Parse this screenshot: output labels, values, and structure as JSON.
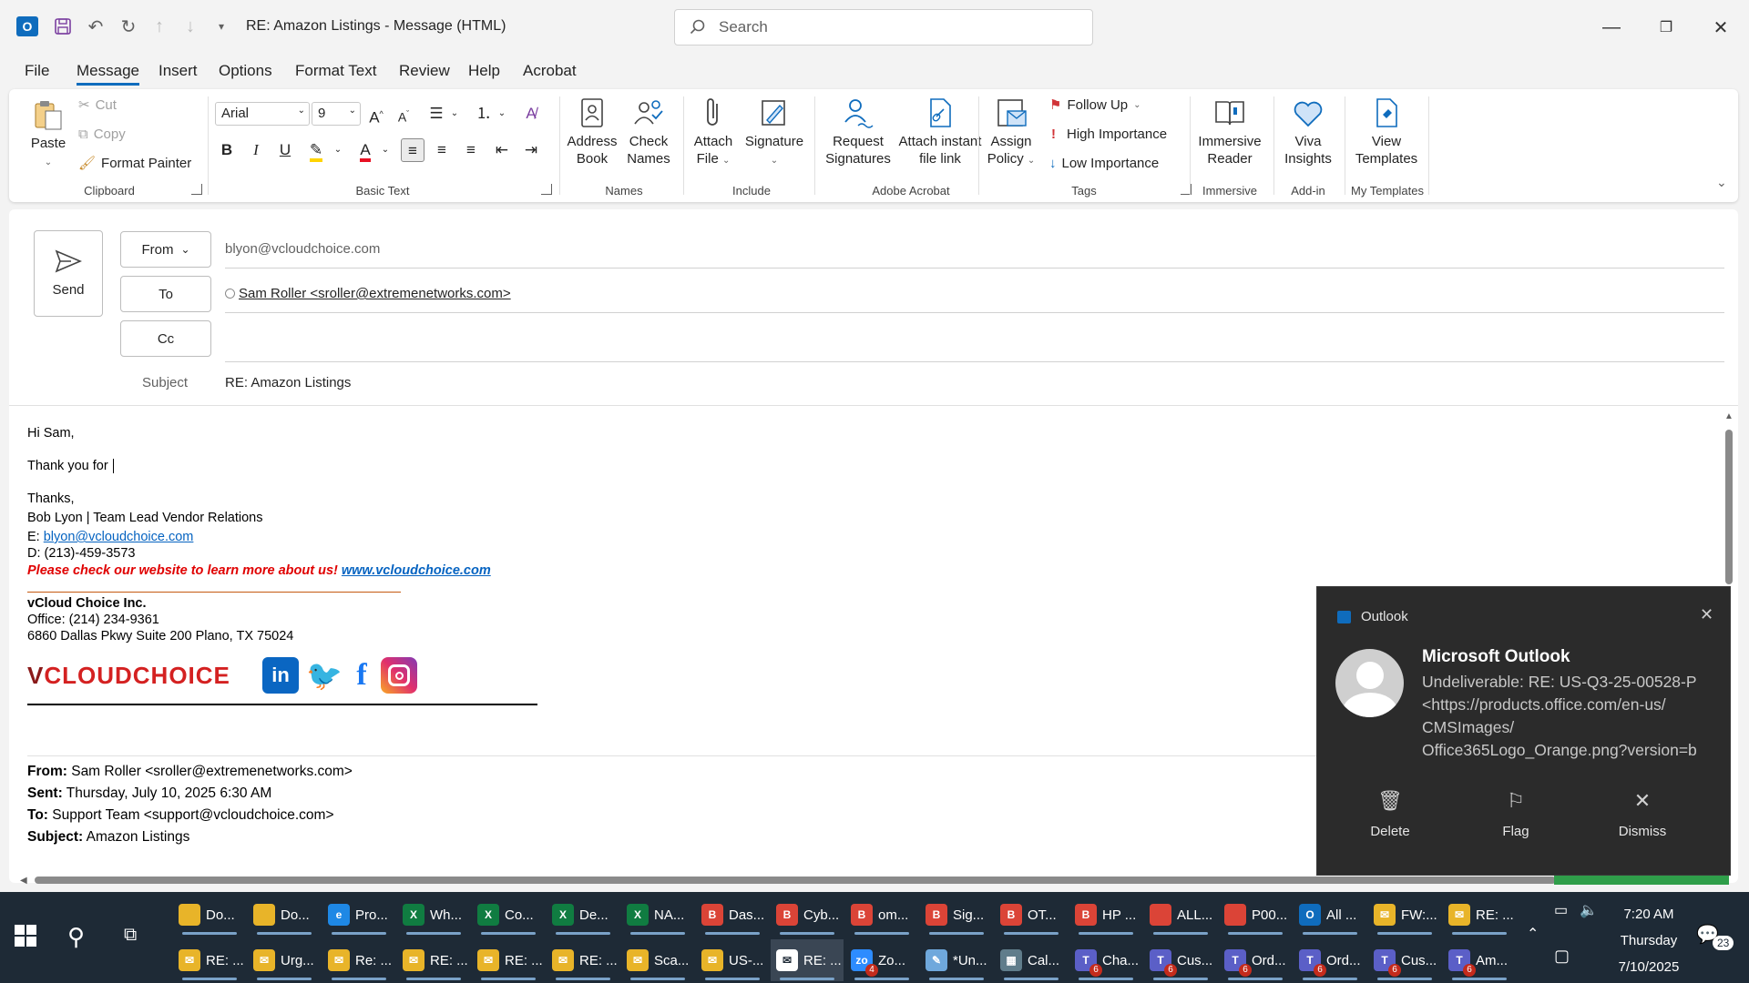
{
  "title_bar": {
    "doc_title": "RE: Amazon Listings  -  Message (HTML)",
    "search_placeholder": "Search"
  },
  "menu_tabs": [
    "File",
    "Message",
    "Insert",
    "Options",
    "Format Text",
    "Review",
    "Help",
    "Acrobat"
  ],
  "ribbon": {
    "clipboard": {
      "paste": "Paste",
      "cut": "Cut",
      "copy": "Copy",
      "format_painter": "Format Painter",
      "group": "Clipboard"
    },
    "basic_text": {
      "font": "Arial",
      "size": "9",
      "group": "Basic Text"
    },
    "names": {
      "address_book_1": "Address",
      "address_book_2": "Book",
      "check_names_1": "Check",
      "check_names_2": "Names",
      "group": "Names"
    },
    "include": {
      "attach_1": "Attach",
      "attach_2": "File",
      "signature": "Signature",
      "group": "Include"
    },
    "adobe": {
      "request_1": "Request",
      "request_2": "Signatures",
      "attach_link_1": "Attach instant",
      "attach_link_2": "file link",
      "group": "Adobe Acrobat"
    },
    "tags": {
      "assign_1": "Assign",
      "assign_2": "Policy",
      "follow_up": "Follow Up",
      "high": "High Importance",
      "low": "Low Importance",
      "group": "Tags"
    },
    "immersive": {
      "btn_1": "Immersive",
      "btn_2": "Reader",
      "group": "Immersive"
    },
    "addin": {
      "btn_1": "Viva",
      "btn_2": "Insights",
      "group": "Add-in"
    },
    "templates": {
      "btn_1": "View",
      "btn_2": "Templates",
      "group": "My Templates"
    }
  },
  "compose": {
    "send": "Send",
    "from_btn": "From",
    "from_value": "blyon@vcloudchoice.com",
    "to_btn": "To",
    "to_value": "Sam Roller <sroller@extremenetworks.com>",
    "cc_btn": "Cc",
    "subject_label": "Subject",
    "subject_value": "RE: Amazon Listings"
  },
  "body": {
    "greeting": "Hi Sam,",
    "line1": "Thank you for ",
    "thanks": "Thanks,",
    "sig_name": "Bob Lyon | Team Lead Vendor Relations",
    "sig_email_label": "E: ",
    "sig_email": "blyon@vcloudchoice.com",
    "sig_phone": "D: (213)-459-3573",
    "sig_promo": "Please check our website to learn more about us! ",
    "sig_website": "www.vcloudchoice.com",
    "company": "vCloud Choice Inc.",
    "office": "Office: (214) 234-9361",
    "address": "6860 Dallas Pkwy Suite 200 Plano, TX 75024",
    "logo_text": "VCLOUDCHOICE",
    "quoted": {
      "from_label": "From:",
      "from": " Sam Roller <sroller@extremenetworks.com>",
      "sent_label": "Sent:",
      "sent": " Thursday, July 10, 2025 6:30 AM",
      "to_label": "To:",
      "to": " Support Team <support@vcloudchoice.com>",
      "subject_label": "Subject:",
      "subject": " Amazon Listings"
    }
  },
  "toast": {
    "app": "Outlook",
    "title": "Microsoft Outlook",
    "message": "Undeliverable: RE: US-Q3-25-00528-P\n<https://products.office.com/en-us/\nCMSImages/\nOffice365Logo_Orange.png?version=b",
    "delete": "Delete",
    "flag": "Flag",
    "dismiss": "Dismiss"
  },
  "taskbar": {
    "row1": [
      {
        "label": "Do...",
        "color": "#e8b429",
        "glyph": ""
      },
      {
        "label": "Do...",
        "color": "#e8b429",
        "glyph": ""
      },
      {
        "label": "Pro...",
        "color": "#1e88e5",
        "glyph": "e"
      },
      {
        "label": "Wh...",
        "color": "#107c41",
        "glyph": "X"
      },
      {
        "label": "Co...",
        "color": "#107c41",
        "glyph": "X"
      },
      {
        "label": "De...",
        "color": "#107c41",
        "glyph": "X"
      },
      {
        "label": "NA...",
        "color": "#107c41",
        "glyph": "X"
      },
      {
        "label": "Das...",
        "color": "#db4437",
        "glyph": "B"
      },
      {
        "label": "Cyb...",
        "color": "#db4437",
        "glyph": "B"
      },
      {
        "label": "om...",
        "color": "#db4437",
        "glyph": "B"
      },
      {
        "label": "Sig...",
        "color": "#db4437",
        "glyph": "B"
      },
      {
        "label": "OT...",
        "color": "#db4437",
        "glyph": "B"
      },
      {
        "label": "HP ...",
        "color": "#db4437",
        "glyph": "B"
      },
      {
        "label": "ALL...",
        "color": "#db4437",
        "glyph": ""
      },
      {
        "label": "P00...",
        "color": "#db4437",
        "glyph": ""
      },
      {
        "label": "All ...",
        "color": "#0f6cbd",
        "glyph": "O"
      },
      {
        "label": "FW:...",
        "color": "#e8b429",
        "glyph": "✉"
      },
      {
        "label": "RE: ...",
        "color": "#e8b429",
        "glyph": "✉"
      }
    ],
    "row2": [
      {
        "label": "RE: ...",
        "color": "#e8b429",
        "glyph": "✉"
      },
      {
        "label": "Urg...",
        "color": "#e8b429",
        "glyph": "✉"
      },
      {
        "label": "Re: ...",
        "color": "#e8b429",
        "glyph": "✉"
      },
      {
        "label": "RE: ...",
        "color": "#e8b429",
        "glyph": "✉"
      },
      {
        "label": "RE: ...",
        "color": "#e8b429",
        "glyph": "✉"
      },
      {
        "label": "RE: ...",
        "color": "#e8b429",
        "glyph": "✉"
      },
      {
        "label": "Sca...",
        "color": "#e8b429",
        "glyph": "✉"
      },
      {
        "label": "US-...",
        "color": "#e8b429",
        "glyph": "✉"
      },
      {
        "label": "RE: ...",
        "color": "#ffffff",
        "glyph": "✉"
      },
      {
        "label": "Zo...",
        "color": "#2d8cff",
        "glyph": "zo",
        "badge": "4"
      },
      {
        "label": "*Un...",
        "color": "#6fa8dc",
        "glyph": "✎"
      },
      {
        "label": "Cal...",
        "color": "#607d8b",
        "glyph": "▦"
      },
      {
        "label": "Cha...",
        "color": "#5b5fc7",
        "glyph": "T",
        "badge": "6"
      },
      {
        "label": "Cus...",
        "color": "#5b5fc7",
        "glyph": "T",
        "badge": "6"
      },
      {
        "label": "Ord...",
        "color": "#5b5fc7",
        "glyph": "T",
        "badge": "6"
      },
      {
        "label": "Ord...",
        "color": "#5b5fc7",
        "glyph": "T",
        "badge": "6"
      },
      {
        "label": "Cus...",
        "color": "#5b5fc7",
        "glyph": "T",
        "badge": "6"
      },
      {
        "label": "Am...",
        "color": "#5b5fc7",
        "glyph": "T",
        "badge": "6"
      }
    ],
    "time": "7:20 AM",
    "day": "Thursday",
    "date": "7/10/2025",
    "notif_count": "23"
  }
}
